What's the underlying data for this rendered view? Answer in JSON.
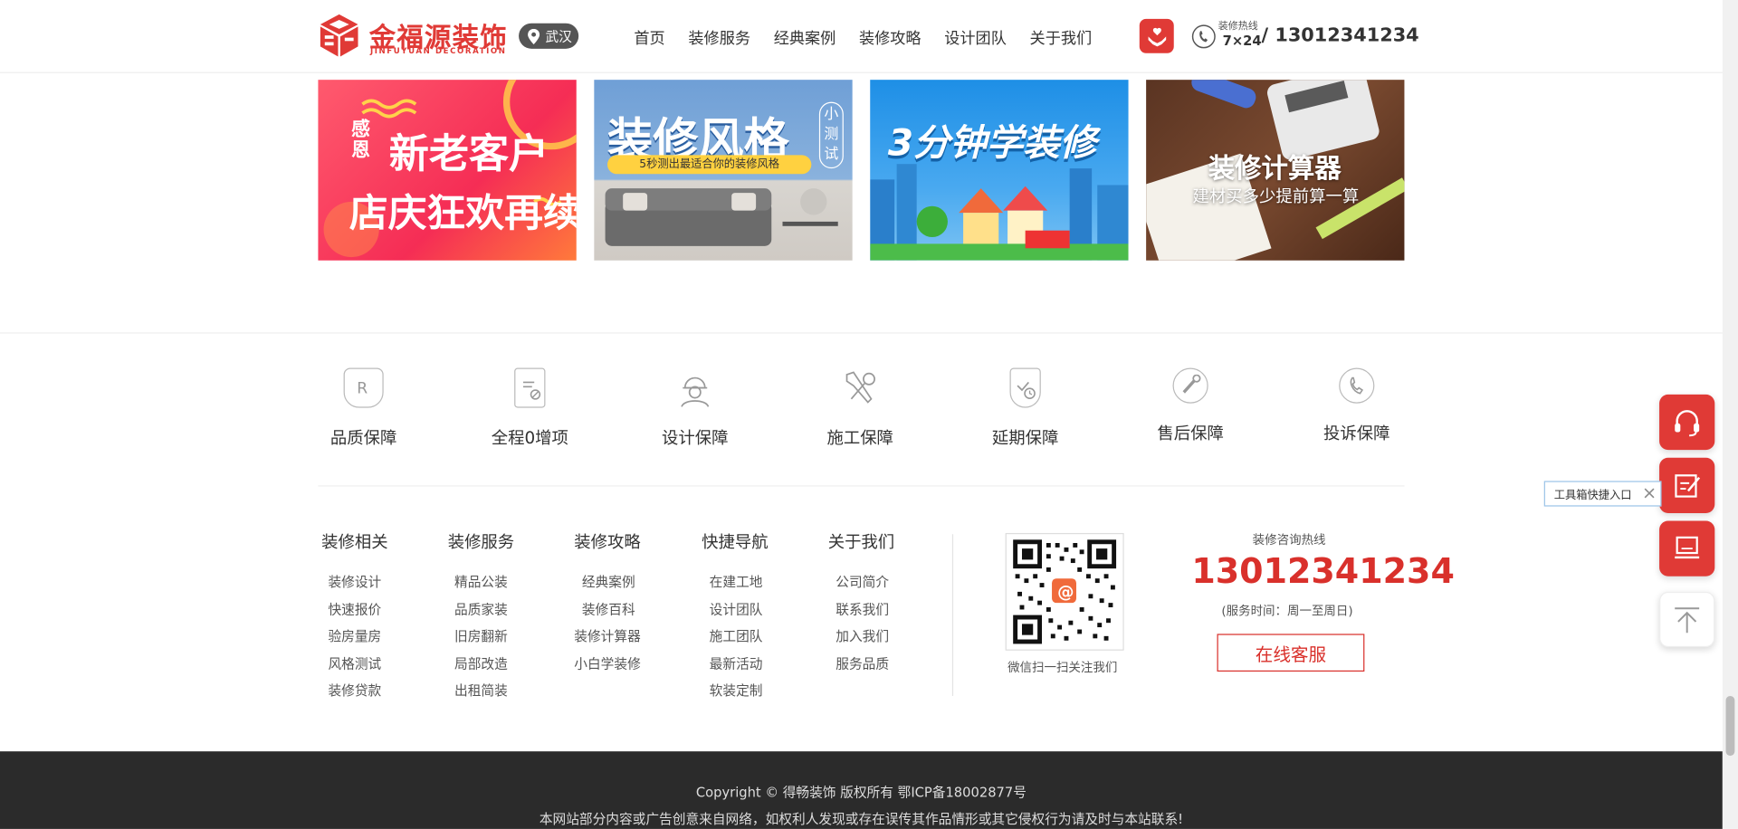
{
  "header": {
    "logo_cn": "金福源装饰",
    "logo_en": "JINFUYUAN DECORATION",
    "city": "武汉",
    "nav": [
      "首页",
      "装修服务",
      "经典案例",
      "装修攻略",
      "设计团队",
      "关于我们"
    ],
    "hotline_label": "装修热线",
    "hotline_hours": "7×24",
    "hotline_number": "/ 13012341234",
    "brand_color": "#e03a36"
  },
  "banners": [
    {
      "line1_small": "感恩",
      "line1": "新老客户",
      "line2": "店庆狂欢再续"
    },
    {
      "title": "装修风格",
      "side": "小测试",
      "subtitle": "5秒测出最适合你的装修风格"
    },
    {
      "title": "3分钟学装修"
    },
    {
      "title": "装修计算器",
      "subtitle": "建材买多少提前算一算"
    }
  ],
  "guarantees": [
    {
      "label": "品质保障",
      "icon": "registered-icon"
    },
    {
      "label": "全程0增项",
      "icon": "document-check-icon"
    },
    {
      "label": "设计保障",
      "icon": "worker-icon"
    },
    {
      "label": "施工保障",
      "icon": "tools-icon"
    },
    {
      "label": "延期保障",
      "icon": "shield-clock-icon"
    },
    {
      "label": "售后保障",
      "icon": "wrench-icon"
    },
    {
      "label": "投诉保障",
      "icon": "phone-icon"
    }
  ],
  "footer_cols": [
    {
      "title": "装修相关",
      "items": [
        "装修设计",
        "快速报价",
        "验房量房",
        "风格测试",
        "装修贷款"
      ]
    },
    {
      "title": "装修服务",
      "items": [
        "精品公装",
        "品质家装",
        "旧房翻新",
        "局部改造",
        "出租简装"
      ]
    },
    {
      "title": "装修攻略",
      "items": [
        "经典案例",
        "装修百科",
        "装修计算器",
        "小白学装修"
      ]
    },
    {
      "title": "快捷导航",
      "items": [
        "在建工地",
        "设计团队",
        "施工团队",
        "最新活动",
        "软装定制"
      ]
    },
    {
      "title": "关于我们",
      "items": [
        "公司简介",
        "联系我们",
        "加入我们",
        "服务品质"
      ]
    }
  ],
  "qr_caption": "微信扫一扫关注我们",
  "consult": {
    "label": "装修咨询热线",
    "number": "13012341234",
    "time": "(服务时间：周一至周日)",
    "button": "在线客服"
  },
  "bottom": {
    "copyright": "Copyright © 得畅装饰 版权所有 鄂ICP备18002877号",
    "disclaimer": "本网站部分内容或广告创意来自网络，如权利人发现或存在误传其作品情形或其它侵权行为请及时与本站联系!"
  },
  "tools": {
    "tooltip": "工具箱快捷入口",
    "items": [
      "headset-icon",
      "edit-icon",
      "laptop-icon",
      "back-to-top-icon"
    ]
  }
}
